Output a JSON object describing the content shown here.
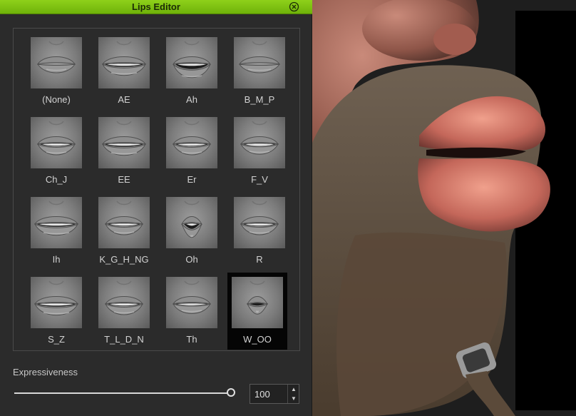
{
  "window": {
    "title": "Lips Editor",
    "close_icon": "close-circle-icon"
  },
  "visemes": [
    {
      "label": "(None)",
      "shape": "closed"
    },
    {
      "label": "AE",
      "shape": "wide-teeth"
    },
    {
      "label": "Ah",
      "shape": "open"
    },
    {
      "label": "B_M_P",
      "shape": "pressed"
    },
    {
      "label": "Ch_J",
      "shape": "teeth"
    },
    {
      "label": "EE",
      "shape": "wide-teeth"
    },
    {
      "label": "Er",
      "shape": "teeth"
    },
    {
      "label": "F_V",
      "shape": "bite"
    },
    {
      "label": "Ih",
      "shape": "wide-teeth"
    },
    {
      "label": "K_G_H_NG",
      "shape": "teeth"
    },
    {
      "label": "Oh",
      "shape": "round-open"
    },
    {
      "label": "R",
      "shape": "teeth"
    },
    {
      "label": "S_Z",
      "shape": "wide-teeth"
    },
    {
      "label": "T_L_D_N",
      "shape": "teeth"
    },
    {
      "label": "Th",
      "shape": "slight"
    },
    {
      "label": "W_OO",
      "shape": "pucker"
    }
  ],
  "selected_viseme": "W_OO",
  "expressiveness": {
    "label": "Expressiveness",
    "value": "100",
    "level": 1.0
  },
  "colors": {
    "titlebar": "#7ec112",
    "panel_bg": "#2b2b2b",
    "selected_bg": "#050505"
  }
}
